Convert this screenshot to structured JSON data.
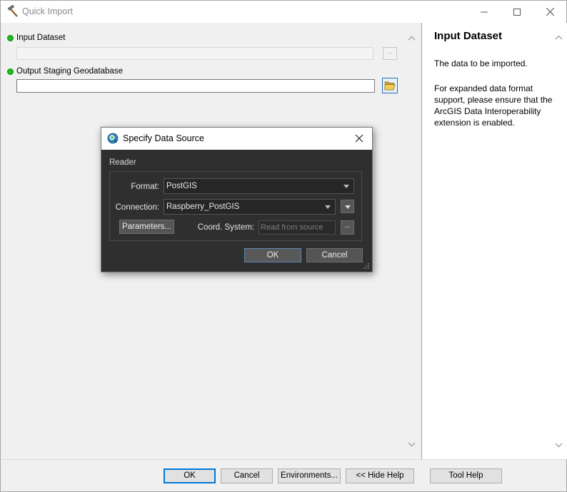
{
  "window": {
    "title": "Quick Import"
  },
  "params": {
    "input_dataset": {
      "label": "Input Dataset",
      "value": "",
      "browse": "..."
    },
    "output_gdb": {
      "label": "Output Staging Geodatabase",
      "value": ""
    }
  },
  "help": {
    "title": "Input Dataset",
    "paragraph1": "The data to be imported.",
    "paragraph2": "For expanded data format support, please ensure that the ArcGIS Data Interoperability extension is enabled."
  },
  "buttons": {
    "ok": "OK",
    "cancel": "Cancel",
    "environments": "Environments...",
    "hide_help": "<< Hide Help",
    "tool_help": "Tool Help"
  },
  "dialog": {
    "title": "Specify Data Source",
    "group_label": "Reader",
    "format_label": "Format:",
    "format_value": "PostGIS",
    "connection_label": "Connection:",
    "connection_value": "Raspberry_PostGIS",
    "parameters_button": "Parameters...",
    "coord_label": "Coord. System:",
    "coord_placeholder": "Read from source",
    "coord_browse": "...",
    "ok": "OK",
    "cancel": "Cancel"
  },
  "icons": {
    "app": "hammer-icon",
    "folder": "folder-open-icon",
    "dialog": "fme-reader-icon"
  },
  "colors": {
    "required_dot": "#1bbf1b",
    "default_button_border": "#0078d7",
    "dialog_bg": "#2f2f2f"
  }
}
